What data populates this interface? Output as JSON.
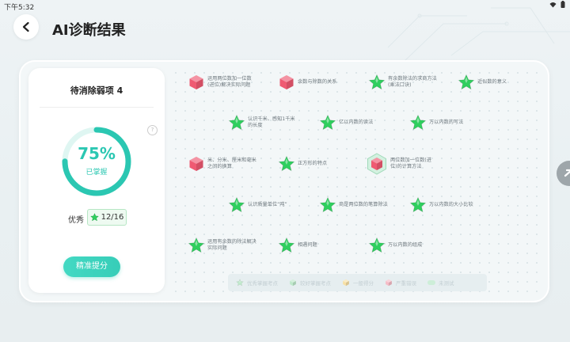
{
  "status": {
    "time": "下午5:32",
    "icons": "wifi-icon battery-icon"
  },
  "header": {
    "title": "AI诊断结果",
    "back_icon": "chevron-left-icon"
  },
  "card": {
    "title": "待消除弱项 4",
    "progress_percent": 75,
    "percent_text": "75%",
    "mastered_label": "已掌握",
    "grade_label": "优秀",
    "grade_value": "12/16",
    "action_label": "精准提分",
    "accent": "#2bc7b2"
  },
  "colors": {
    "green": "#2fcf5e",
    "red": "#ef5a72",
    "yellow": "#f5c24c"
  },
  "knowledge_points": [
    {
      "lines": [
        "运用两位数加一位数",
        "(进位)解决实际问题"
      ],
      "status": "red"
    },
    {
      "lines": [
        "余数与除数的关系"
      ],
      "status": "red"
    },
    {
      "lines": [
        "有余数除法的求商方法",
        "(乘法口诀)"
      ],
      "status": "green"
    },
    {
      "lines": [
        "近似数的意义"
      ],
      "status": "green"
    },
    {
      "lines": [
        "认识千米、感知1千米",
        "的长度"
      ],
      "status": "green"
    },
    {
      "lines": [
        "亿以内数的读法"
      ],
      "status": "green"
    },
    {
      "lines": [
        "万以内数的写法"
      ],
      "status": "green"
    },
    {
      "lines": [
        "米、分米、厘米和毫米",
        "之间的换算"
      ],
      "status": "red"
    },
    {
      "lines": [
        "正方形的特点"
      ],
      "status": "green"
    },
    {
      "lines": [
        "两位数加一位数(进",
        "位)的计算方法"
      ],
      "status": "red",
      "selected": true
    },
    {
      "lines": [
        "认识质量单位“吨”"
      ],
      "status": "green"
    },
    {
      "lines": [
        "商是两位数的笔算除法"
      ],
      "status": "green"
    },
    {
      "lines": [
        "万以内数的大小比较"
      ],
      "status": "green"
    },
    {
      "lines": [
        "运用有余数的除法解决",
        "实际问题"
      ],
      "status": "green"
    },
    {
      "lines": [
        "相遇问题"
      ],
      "status": "green"
    },
    {
      "lines": [
        "万以内数的组成"
      ],
      "status": "green"
    }
  ],
  "legend": [
    {
      "label": "优秀掌握考点",
      "shape": "star",
      "color": "#bfe9cb"
    },
    {
      "label": "较好掌握考点",
      "shape": "cube",
      "color": "#bfe9cb"
    },
    {
      "label": "一般得分",
      "shape": "cube",
      "color": "#f7e0a6"
    },
    {
      "label": "严重错误",
      "shape": "cube",
      "color": "#f6bcc6"
    },
    {
      "label": "未测试",
      "shape": "pill",
      "color": "#cdeed8"
    }
  ],
  "side_button_icon": "collapse-arrow-icon"
}
